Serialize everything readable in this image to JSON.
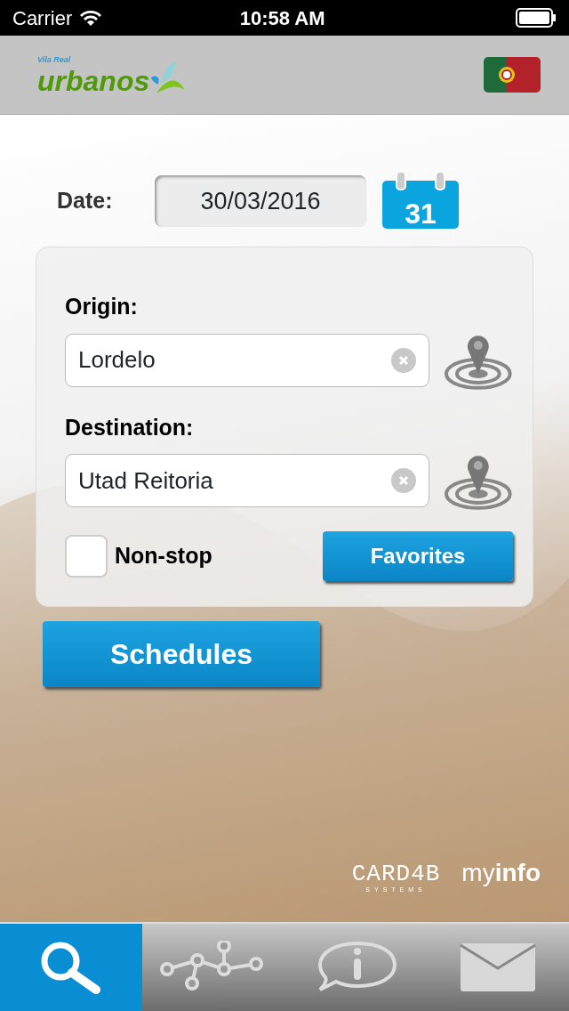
{
  "status_bar": {
    "carrier": "Carrier",
    "time": "10:58 AM"
  },
  "header": {
    "logo_small": "Vila Real",
    "logo_main": "urbanos"
  },
  "date": {
    "label": "Date:",
    "value": "30/03/2016",
    "calendar_day": "31"
  },
  "route": {
    "fields": [
      {
        "label": "Origin:",
        "value": "Lordelo"
      },
      {
        "label": "Destination:",
        "value": "Utad Reitoria"
      }
    ],
    "non_stop": {
      "label": "Non-stop",
      "checked": false
    },
    "favorites_button": "Favorites"
  },
  "schedules_button": "Schedules",
  "footer": {
    "brand_main": "CARD4B",
    "brand_sub": "SYSTEMS",
    "myinfo_light": "my",
    "myinfo_bold": "info"
  },
  "tabs": [
    {
      "kind": "search",
      "selected": true
    },
    {
      "kind": "network",
      "selected": false
    },
    {
      "kind": "info",
      "selected": false
    },
    {
      "kind": "mail",
      "selected": false
    }
  ]
}
